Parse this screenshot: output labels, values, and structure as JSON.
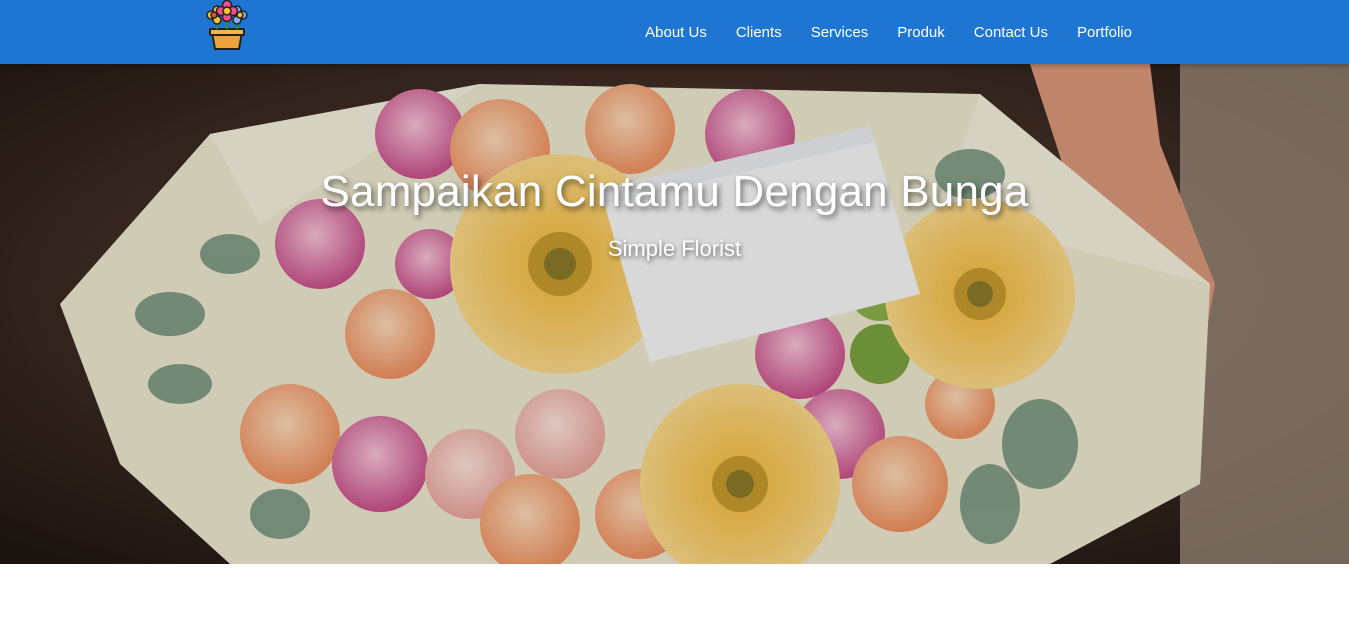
{
  "brand": {
    "logo_icon": "flower-pot-icon"
  },
  "nav": {
    "items": [
      {
        "label": "About Us"
      },
      {
        "label": "Clients"
      },
      {
        "label": "Services"
      },
      {
        "label": "Produk"
      },
      {
        "label": "Contact Us"
      },
      {
        "label": "Portfolio"
      }
    ]
  },
  "hero": {
    "title": "Sampaikan Cintamu Dengan Bunga",
    "subtitle": "Simple Florist",
    "image": "flower-bouquet-photo"
  },
  "colors": {
    "navbar": "#1e76d2",
    "nav_text": "#ffffff",
    "hero_text": "#ffffff"
  }
}
